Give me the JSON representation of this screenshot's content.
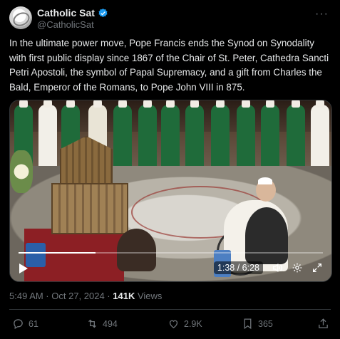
{
  "account": {
    "display_name": "Catholic Sat",
    "handle": "@CatholicSat",
    "verified_color": "#1d9bf0"
  },
  "post": {
    "text": "In the ultimate power move, Pope Francis ends the Synod on Synodality with first public display since 1867 of the Chair of St. Peter, Cathedra Sancti Petri Apostoli, the symbol of Papal Supremacy, and a gift from Charles the Bald, Emperor of the Romans, to Pope John VIII in 875.",
    "timestamp": "5:49 AM · Oct 27, 2024 · ",
    "views_count": "141K",
    "views_label": " Views"
  },
  "video": {
    "time": "1:38 / 6:28",
    "progress_fraction": 0.253
  },
  "actions": {
    "replies": "61",
    "reposts": "494",
    "likes": "2.9K",
    "bookmarks": "365"
  },
  "icons": [
    "verified-badge-icon",
    "more-icon",
    "play-icon",
    "volume-icon",
    "settings-icon",
    "fullscreen-icon",
    "reply-icon",
    "repost-icon",
    "like-icon",
    "bookmark-icon",
    "share-icon"
  ]
}
